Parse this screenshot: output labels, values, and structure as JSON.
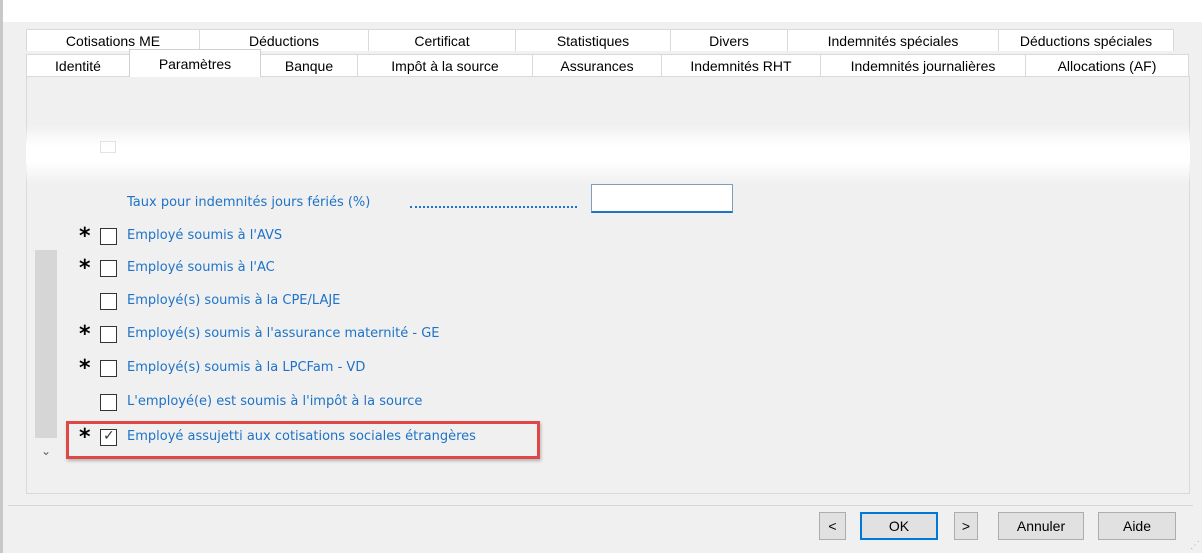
{
  "tabs": {
    "row1": [
      "Cotisations ME",
      "Déductions",
      "Certificat",
      "Statistiques",
      "Divers",
      "Indemnités spéciales",
      "Déductions spéciales"
    ],
    "row2": [
      "Identité",
      "Paramètres",
      "Banque",
      "Impôt à la source",
      "Assurances",
      "Indemnités RHT",
      "Indemnités journalières",
      "Allocations (AF)"
    ],
    "active": "Paramètres"
  },
  "form": {
    "rate_label": "Taux pour indemnités jours fériés (%)",
    "rate_value": "",
    "options": [
      {
        "label": "Employé soumis à l'AVS",
        "required": true,
        "checked": false
      },
      {
        "label": "Employé soumis à l'AC",
        "required": true,
        "checked": false
      },
      {
        "label": "Employé(s) soumis à la CPE/LAJE",
        "required": false,
        "checked": false
      },
      {
        "label": "Employé(s) soumis à l'assurance maternité - GE",
        "required": true,
        "checked": false
      },
      {
        "label": "Employé(s) soumis à la LPCFam - VD",
        "required": true,
        "checked": false
      },
      {
        "label": "L'employé(e) est soumis à l'impôt à la source",
        "required": false,
        "checked": false
      },
      {
        "label": "Employé assujetti aux cotisations sociales étrangères",
        "required": true,
        "checked": true
      }
    ],
    "star_symbol": "*",
    "check_symbol": "✓"
  },
  "buttons": {
    "prev": "<",
    "ok": "OK",
    "next": ">",
    "cancel": "Annuler",
    "help": "Aide"
  },
  "scroll": {
    "down_symbol": "⌄"
  },
  "colors": {
    "label": "#1e73c8",
    "highlight": "#e04848",
    "primary_border": "#0078d7"
  }
}
